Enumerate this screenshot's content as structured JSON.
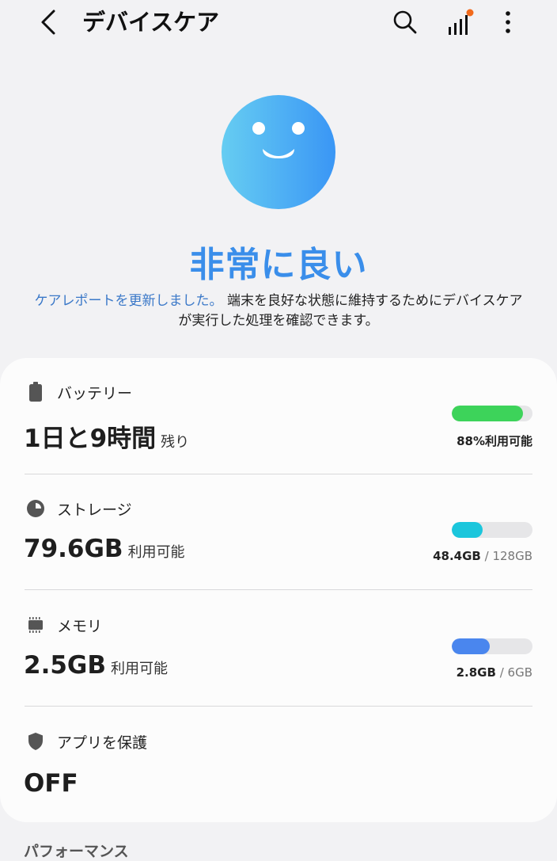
{
  "header": {
    "title": "デバイスケア"
  },
  "status": {
    "title": "非常に良い",
    "link_text": "ケアレポートを更新しました。",
    "description": "端末を良好な状態に維持するためにデバイスケアが実行した処理を確認できます。"
  },
  "battery": {
    "label": "バッテリー",
    "value": "1日と9時間",
    "unit": "残り",
    "level": 0.88,
    "bar_text": "88%利用可能",
    "color": "#3dd35a"
  },
  "storage": {
    "label": "ストレージ",
    "value": "79.6GB",
    "unit": "利用可能",
    "level": 0.378,
    "used": "48.4GB",
    "separator": " / ",
    "total": "128GB",
    "color": "#1bc6dc"
  },
  "memory": {
    "label": "メモリ",
    "value": "2.5GB",
    "unit": "利用可能",
    "level": 0.467,
    "used": "2.8GB",
    "separator": " / ",
    "total": "6GB",
    "color": "#4a86ee"
  },
  "app_protection": {
    "label": "アプリを保護",
    "value": "OFF"
  },
  "performance": {
    "label": "パフォーマンス"
  },
  "icons": [
    "back-arrow-icon",
    "search-icon",
    "signal-bars-icon",
    "more-options-icon",
    "smiley-face-icon",
    "battery-icon",
    "pie-chart-icon",
    "memory-chip-icon",
    "shield-icon"
  ]
}
